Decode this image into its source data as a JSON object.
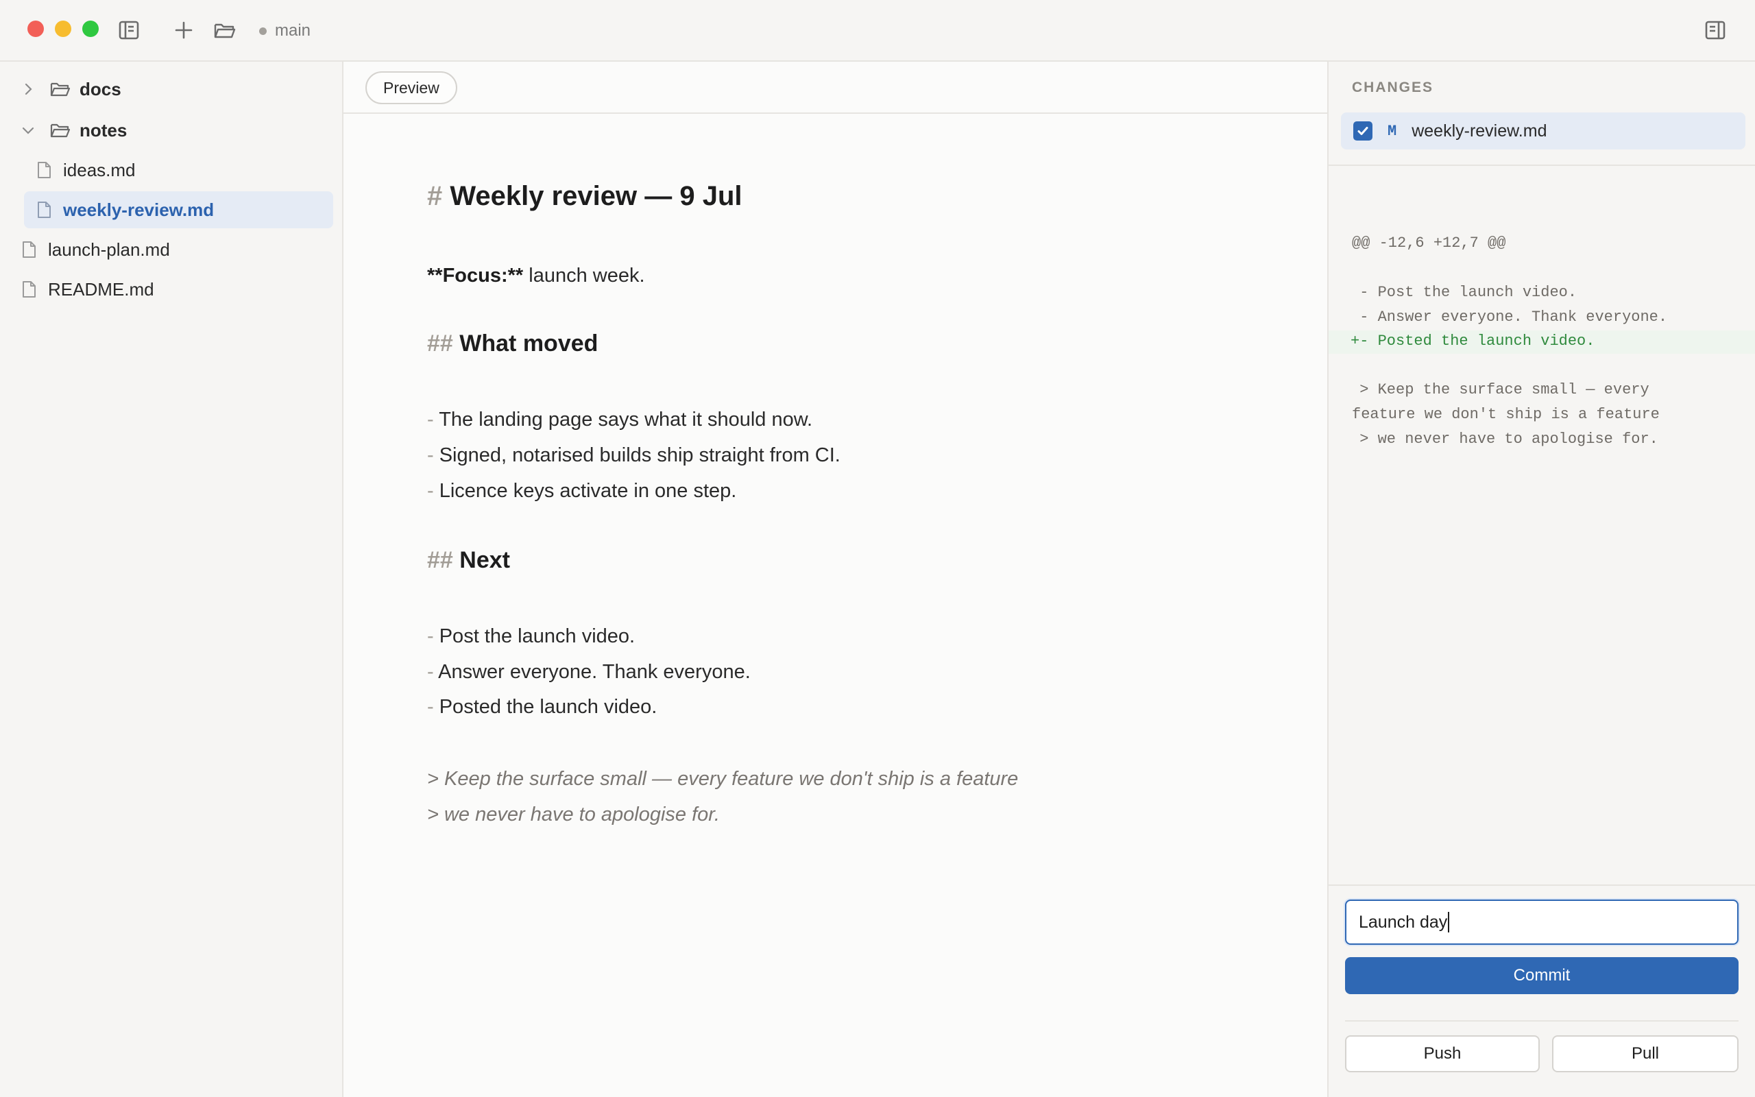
{
  "titlebar": {
    "branch": "main",
    "colors": {
      "close": "#f25f57",
      "minimize": "#f7bc2f",
      "zoom": "#2fc840"
    }
  },
  "sidebar": {
    "items": [
      {
        "label": "docs",
        "kind": "folder",
        "expanded": false
      },
      {
        "label": "notes",
        "kind": "folder",
        "expanded": true
      },
      {
        "label": "ideas.md",
        "kind": "file"
      },
      {
        "label": "weekly-review.md",
        "kind": "file",
        "selected": true
      },
      {
        "label": "launch-plan.md",
        "kind": "file"
      },
      {
        "label": "README.md",
        "kind": "file"
      }
    ]
  },
  "editor": {
    "preview_label": "Preview",
    "h1_mark": "#",
    "h1_text": "Weekly review — 9 Jul",
    "focus_bold": "**Focus:**",
    "focus_rest": " launch week.",
    "h2_mark": "##",
    "h2_what": "What moved",
    "h2_next": "Next",
    "bullet": "- ",
    "moved": [
      "The landing page says what it should now.",
      "Signed, notarised builds ship straight from CI.",
      "Licence keys activate in one step."
    ],
    "next": [
      "Post the launch video.",
      "Answer everyone. Thank everyone.",
      "Posted the launch video."
    ],
    "quote": [
      "> Keep the surface small — every feature we don't ship is a feature",
      "> we never have to apologise for."
    ]
  },
  "changes": {
    "title": "CHANGES",
    "file_status": "M",
    "file_name": "weekly-review.md",
    "checked": true,
    "diff": [
      "@@ -12,6 +12,7 @@",
      " - Post the launch video.",
      " - Answer everyone. Thank everyone.",
      "+- Posted the launch video.",
      " > Keep the surface small — every",
      "feature we don't ship is a feature",
      " > we never have to apologise for."
    ],
    "commit_message": "Launch day",
    "commit_label": "Commit",
    "push_label": "Push",
    "pull_label": "Pull",
    "accent": "#2f68b4",
    "added_color": "#2f8a3d"
  }
}
